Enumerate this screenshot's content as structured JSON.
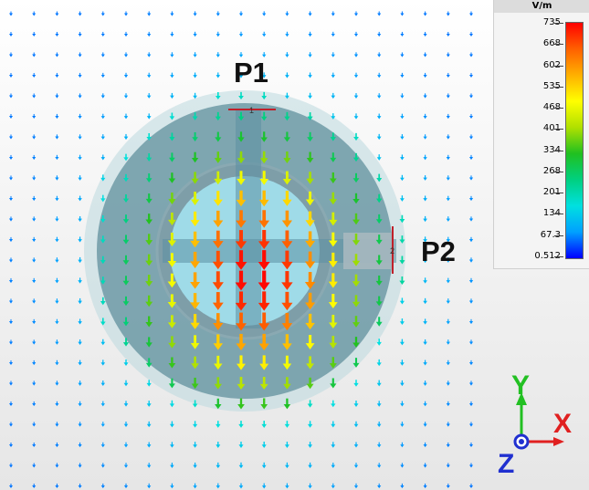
{
  "ports": {
    "p1_label": "P1",
    "p2_label": "P2",
    "p1_marker": "1",
    "p2_marker": "2"
  },
  "legend": {
    "unit": "V/m",
    "ticks": [
      "735",
      "668",
      "602",
      "535",
      "468",
      "401",
      "334",
      "268",
      "201",
      "134",
      "67.3",
      "0.512"
    ],
    "max": 735,
    "min": 0.512
  },
  "axes": {
    "x_label": "X",
    "y_label": "Y",
    "z_label": "Z",
    "x_color": "#e02020",
    "y_color": "#22c022",
    "z_color": "#2030d0"
  },
  "field": {
    "quantity": "E-field magnitude",
    "arrow_direction": "down",
    "peak_value": 735,
    "colormap": [
      "#0000ff",
      "#00a0ff",
      "#00e0e0",
      "#00d080",
      "#20c020",
      "#b0e000",
      "#ffff00",
      "#ffb000",
      "#ff6000",
      "#ff0000"
    ]
  },
  "icons": {
    "arrow": "field-arrow-icon",
    "triad": "axis-triad-icon"
  }
}
